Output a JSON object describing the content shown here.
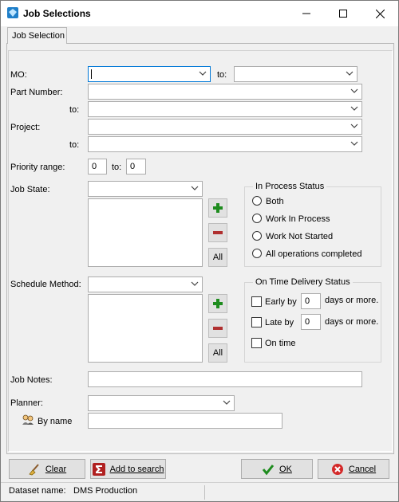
{
  "window": {
    "title": "Job Selections",
    "minimize": "—",
    "maximize": "☐",
    "close": "✕"
  },
  "tab": {
    "label": "Job Selection"
  },
  "mo": {
    "label": "MO:",
    "to_label": "to:"
  },
  "part_number": {
    "label": "Part Number:",
    "to_label": "to:"
  },
  "project": {
    "label": "Project:",
    "to_label": "to:"
  },
  "priority": {
    "label": "Priority range:",
    "from_value": "0",
    "to_label": "to:",
    "to_value": "0"
  },
  "job_state": {
    "label": "Job State:",
    "all_label": "All"
  },
  "in_process_status": {
    "legend": "In Process Status",
    "options": [
      "Both",
      "Work In Process",
      "Work Not Started",
      "All operations completed"
    ]
  },
  "schedule_method": {
    "label": "Schedule Method:",
    "all_label": "All"
  },
  "on_time_delivery": {
    "legend": "On Time Delivery Status",
    "early_label": "Early by",
    "early_value": "0",
    "late_label": "Late by",
    "late_value": "0",
    "days_label": "days or more.",
    "on_time_label": "On time"
  },
  "job_notes": {
    "label": "Job Notes:"
  },
  "planner": {
    "label": "Planner:",
    "by_name_label": "By name"
  },
  "buttons": {
    "clear": "Clear",
    "add_to_search": "Add to search",
    "ok": "OK",
    "cancel": "Cancel"
  },
  "status": {
    "dataset_label": "Dataset name:",
    "dataset_value": "DMS Production"
  },
  "colors": {
    "accent": "#0078d7",
    "green": "#1e8c1e",
    "red": "#b03030"
  }
}
